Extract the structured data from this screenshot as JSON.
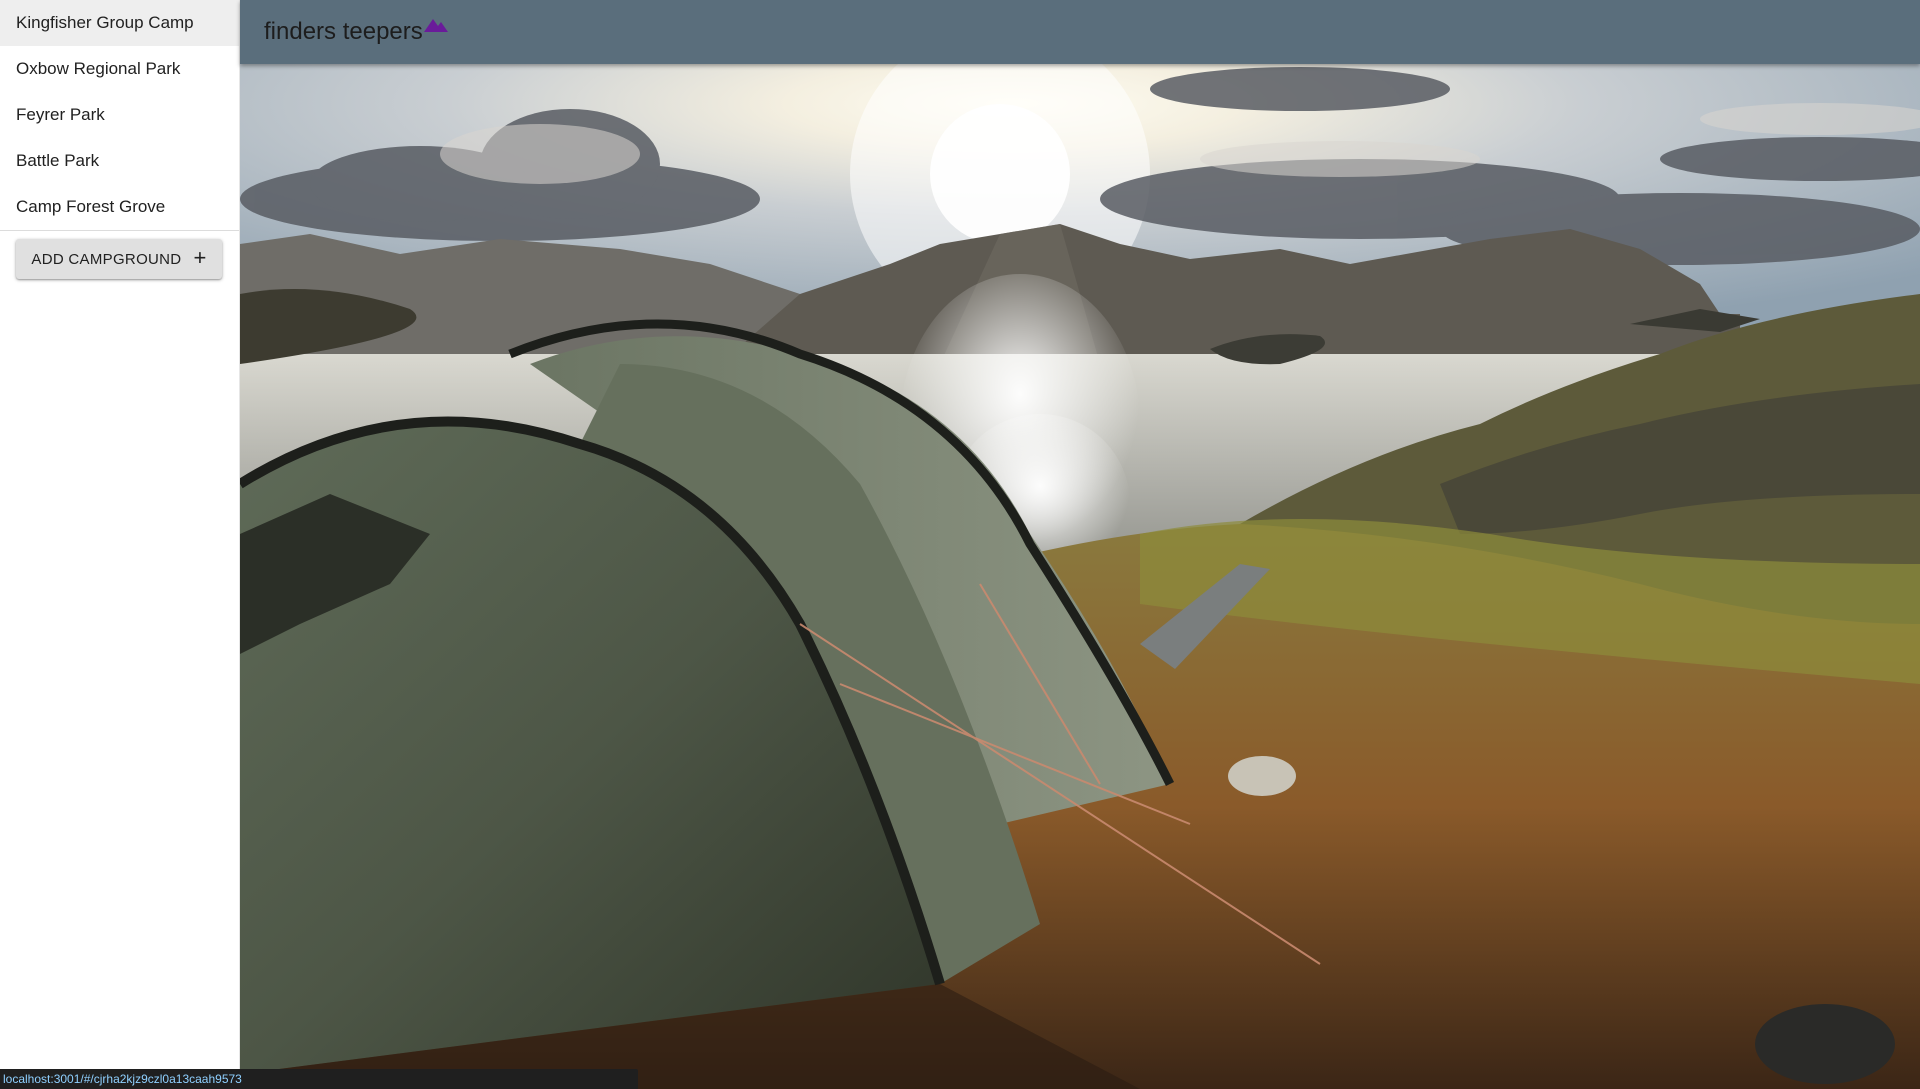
{
  "header": {
    "title": "finders teepers",
    "logo_icon": "mountain-icon",
    "logo_color": "#6a1b9a",
    "bg_color": "#5a6e7c"
  },
  "sidebar": {
    "items": [
      {
        "label": "Kingfisher Group Camp",
        "selected": true
      },
      {
        "label": "Oxbow Regional Park",
        "selected": false
      },
      {
        "label": "Feyrer Park",
        "selected": false
      },
      {
        "label": "Battle Park",
        "selected": false
      },
      {
        "label": "Camp Forest Grove",
        "selected": false
      }
    ],
    "add_button": {
      "label": "ADD CAMPGROUND",
      "icon": "plus-icon"
    }
  },
  "hero": {
    "image": "tent-by-lake-sunset-photo"
  },
  "status_bar": {
    "url": "localhost:3001/#/cjrha2kjz9czl0a13caah9573"
  }
}
